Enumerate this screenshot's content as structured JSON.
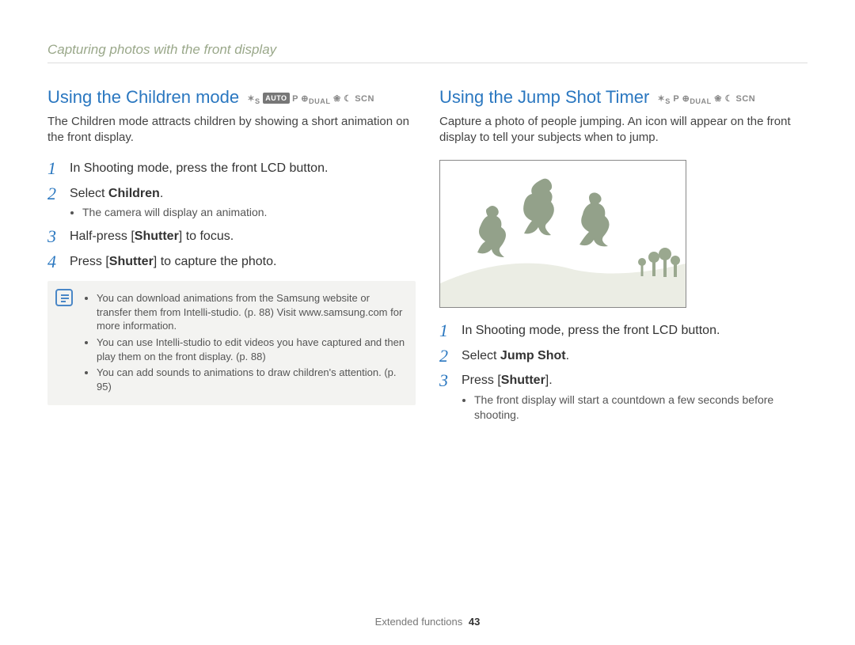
{
  "running_head": "Capturing photos with the front display",
  "footer": {
    "section": "Extended functions",
    "page": "43"
  },
  "left": {
    "title": "Using the Children mode",
    "mode_icons_text": "S AUTO P DUAL SCN",
    "lead": "The Children mode attracts children by showing a short animation on the front display.",
    "steps": [
      {
        "num": "1",
        "pre": "In Shooting mode, press the front LCD button.",
        "bold": "",
        "post": ""
      },
      {
        "num": "2",
        "pre": "Select ",
        "bold": "Children",
        "post": ".",
        "sub": [
          "The camera will display an animation."
        ]
      },
      {
        "num": "3",
        "pre": "Half-press [",
        "bold": "Shutter",
        "post": "] to focus."
      },
      {
        "num": "4",
        "pre": "Press [",
        "bold": "Shutter",
        "post": "] to capture the photo."
      }
    ],
    "note": [
      "You can download animations from the Samsung website or transfer them from Intelli-studio. (p. 88) Visit www.samsung.com for more information.",
      "You can use Intelli-studio to edit videos you have captured and then play them on the front display. (p. 88)",
      "You can add sounds to animations to draw children's attention. (p. 95)"
    ]
  },
  "right": {
    "title": "Using the Jump Shot Timer",
    "mode_icons_text": "S P DUAL SCN",
    "lead": "Capture a photo of people jumping. An icon will appear on the front display to tell your subjects when to jump.",
    "steps": [
      {
        "num": "1",
        "pre": "In Shooting mode, press the front LCD button.",
        "bold": "",
        "post": ""
      },
      {
        "num": "2",
        "pre": "Select ",
        "bold": "Jump Shot",
        "post": "."
      },
      {
        "num": "3",
        "pre": "Press [",
        "bold": "Shutter",
        "post": "].",
        "sub": [
          "The front display will start a countdown a few seconds before shooting."
        ]
      }
    ]
  }
}
